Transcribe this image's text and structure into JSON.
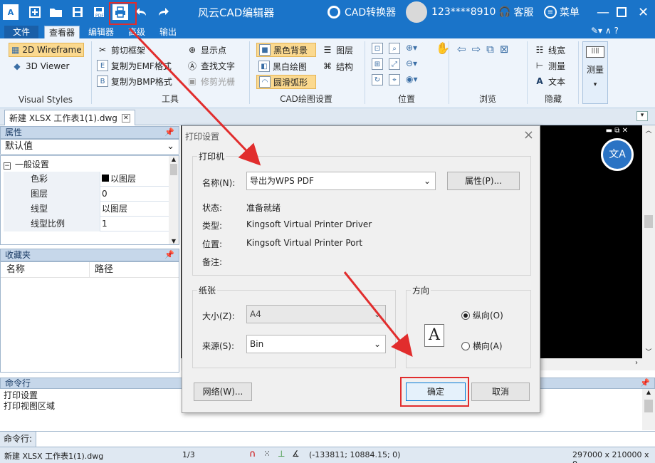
{
  "window": {
    "title": "风云CAD编辑器",
    "converter_label": "CAD转换器",
    "user_name": "123****8910",
    "service_label": "客服",
    "menu_label": "菜单"
  },
  "menu_tabs": [
    "文件",
    "查看器",
    "编辑器",
    "高级",
    "输出"
  ],
  "ribbon": {
    "visual_styles": {
      "wireframe_2d": "2D Wireframe",
      "viewer_3d": "3D Viewer",
      "label": "Visual Styles"
    },
    "tools": {
      "clip_frame": "剪切框架",
      "copy_emf": "复制为EMF格式",
      "copy_bmp": "复制为BMP格式",
      "show_points": "显示点",
      "find_text": "查找文字",
      "trim_raster": "修剪光栅",
      "label": "工具"
    },
    "cad_settings": {
      "black_bg": "黑色背景",
      "bw_draw": "黑白绘图",
      "smooth_arc": "圆滑弧形",
      "layers": "图层",
      "structure": "结构",
      "label": "CAD绘图设置"
    },
    "position": {
      "label": "位置"
    },
    "browse": {
      "label": "浏览"
    },
    "hide": {
      "linewidth": "线宽",
      "measure": "测量",
      "text": "文本",
      "label": "隐藏"
    },
    "measure_big": "测量"
  },
  "doc_tab": {
    "name": "新建 XLSX 工作表1(1).dwg"
  },
  "properties": {
    "header": "属性",
    "default_value": "默认值",
    "section": "一般设置",
    "rows": [
      {
        "name": "色彩",
        "value": "以图层"
      },
      {
        "name": "图层",
        "value": "0"
      },
      {
        "name": "线型",
        "value": "以图层"
      },
      {
        "name": "线型比例",
        "value": "1"
      }
    ]
  },
  "favorites": {
    "header": "收藏夹",
    "col_name": "名称",
    "col_path": "路径"
  },
  "command": {
    "header": "命令行",
    "lines": [
      "打印设置",
      "打印视图区域"
    ],
    "prompt": "命令行:"
  },
  "status": {
    "file": "新建 XLSX 工作表1(1).dwg",
    "page": "1/3",
    "coords": "(-133811; 10884.15; 0)",
    "size": "297000 x 210000 x 0"
  },
  "dialog": {
    "title": "打印设置",
    "printer_group": "打印机",
    "name_label": "名称(N):",
    "name_value": "导出为WPS PDF",
    "properties_button": "属性(P)...",
    "status_label": "状态:",
    "status_value": "准备就绪",
    "type_label": "类型:",
    "type_value": "Kingsoft Virtual Printer Driver",
    "location_label": "位置:",
    "location_value": "Kingsoft Virtual Printer Port",
    "comment_label": "备注:",
    "paper_group": "纸张",
    "size_label": "大小(Z):",
    "size_value": "A4",
    "source_label": "来源(S):",
    "source_value": "Bin",
    "orientation_group": "方向",
    "portrait_label": "纵向(O)",
    "landscape_label": "横向(A)",
    "orientation_letter": "A",
    "network_button": "网络(W)...",
    "ok_button": "确定",
    "cancel_button": "取消"
  },
  "colors": {
    "titlebar": "#1a74c9",
    "ribbon": "#eef4fb",
    "highlight": "#fbd98f",
    "annotation_red": "#e12d2d",
    "canvas": "#000000"
  }
}
